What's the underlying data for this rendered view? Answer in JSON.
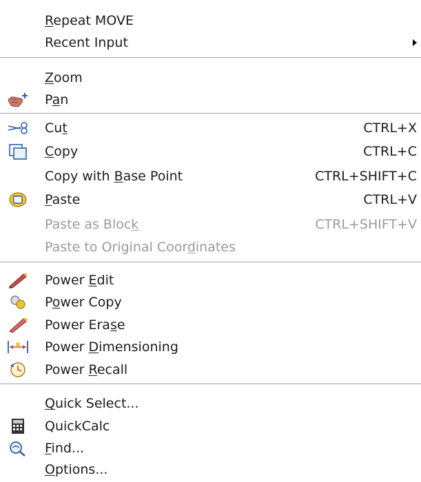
{
  "menu": {
    "items": [
      {
        "id": "repeat-move",
        "label": "Repeat MOVE",
        "mnemonic_index": 0,
        "shortcut": "",
        "disabled": false,
        "submenu": false,
        "icon": ""
      },
      {
        "id": "recent-input",
        "label": "Recent Input",
        "mnemonic_index": -1,
        "shortcut": "",
        "disabled": false,
        "submenu": true,
        "icon": ""
      },
      {
        "id": "zoom",
        "label": "Zoom",
        "mnemonic_index": 0,
        "shortcut": "",
        "disabled": false,
        "submenu": false,
        "icon": ""
      },
      {
        "id": "pan",
        "label": "Pan",
        "mnemonic_index": 1,
        "shortcut": "",
        "disabled": false,
        "submenu": false,
        "icon": "pan-hand-icon"
      },
      {
        "id": "cut",
        "label": "Cut",
        "mnemonic_index": 2,
        "shortcut": "CTRL+X",
        "disabled": false,
        "submenu": false,
        "icon": "scissors-icon"
      },
      {
        "id": "copy",
        "label": "Copy",
        "mnemonic_index": 0,
        "shortcut": "CTRL+C",
        "disabled": false,
        "submenu": false,
        "icon": "copy-icon"
      },
      {
        "id": "copy-base-point",
        "label": "Copy with Base Point",
        "mnemonic_index": 10,
        "shortcut": "CTRL+SHIFT+C",
        "disabled": false,
        "submenu": false,
        "icon": ""
      },
      {
        "id": "paste",
        "label": "Paste",
        "mnemonic_index": 0,
        "shortcut": "CTRL+V",
        "disabled": false,
        "submenu": false,
        "icon": "paste-icon"
      },
      {
        "id": "paste-as-block",
        "label": "Paste as Block",
        "mnemonic_index": 13,
        "shortcut": "CTRL+SHIFT+V",
        "disabled": true,
        "submenu": false,
        "icon": ""
      },
      {
        "id": "paste-original-coords",
        "label": "Paste to Original Coordinates",
        "mnemonic_index": 22,
        "shortcut": "",
        "disabled": true,
        "submenu": false,
        "icon": ""
      },
      {
        "id": "power-edit",
        "label": "Power Edit",
        "mnemonic_index": 6,
        "shortcut": "",
        "disabled": false,
        "submenu": false,
        "icon": "power-edit-icon"
      },
      {
        "id": "power-copy",
        "label": "Power Copy",
        "mnemonic_index": 1,
        "shortcut": "",
        "disabled": false,
        "submenu": false,
        "icon": "power-copy-icon"
      },
      {
        "id": "power-erase",
        "label": "Power Erase",
        "mnemonic_index": 9,
        "shortcut": "",
        "disabled": false,
        "submenu": false,
        "icon": "power-erase-icon"
      },
      {
        "id": "power-dimensioning",
        "label": "Power Dimensioning",
        "mnemonic_index": 6,
        "shortcut": "",
        "disabled": false,
        "submenu": false,
        "icon": "power-dimensioning-icon"
      },
      {
        "id": "power-recall",
        "label": "Power Recall",
        "mnemonic_index": 6,
        "shortcut": "",
        "disabled": false,
        "submenu": false,
        "icon": "power-recall-icon"
      },
      {
        "id": "quick-select",
        "label": "Quick Select...",
        "mnemonic_index": 0,
        "shortcut": "",
        "disabled": false,
        "submenu": false,
        "icon": ""
      },
      {
        "id": "quickcalc",
        "label": "QuickCalc",
        "mnemonic_index": -1,
        "shortcut": "",
        "disabled": false,
        "submenu": false,
        "icon": "calculator-icon"
      },
      {
        "id": "find",
        "label": "Find...",
        "mnemonic_index": 0,
        "shortcut": "",
        "disabled": false,
        "submenu": false,
        "icon": "find-icon"
      },
      {
        "id": "options",
        "label": "Options...",
        "mnemonic_index": 0,
        "shortcut": "",
        "disabled": false,
        "submenu": false,
        "icon": ""
      }
    ]
  }
}
